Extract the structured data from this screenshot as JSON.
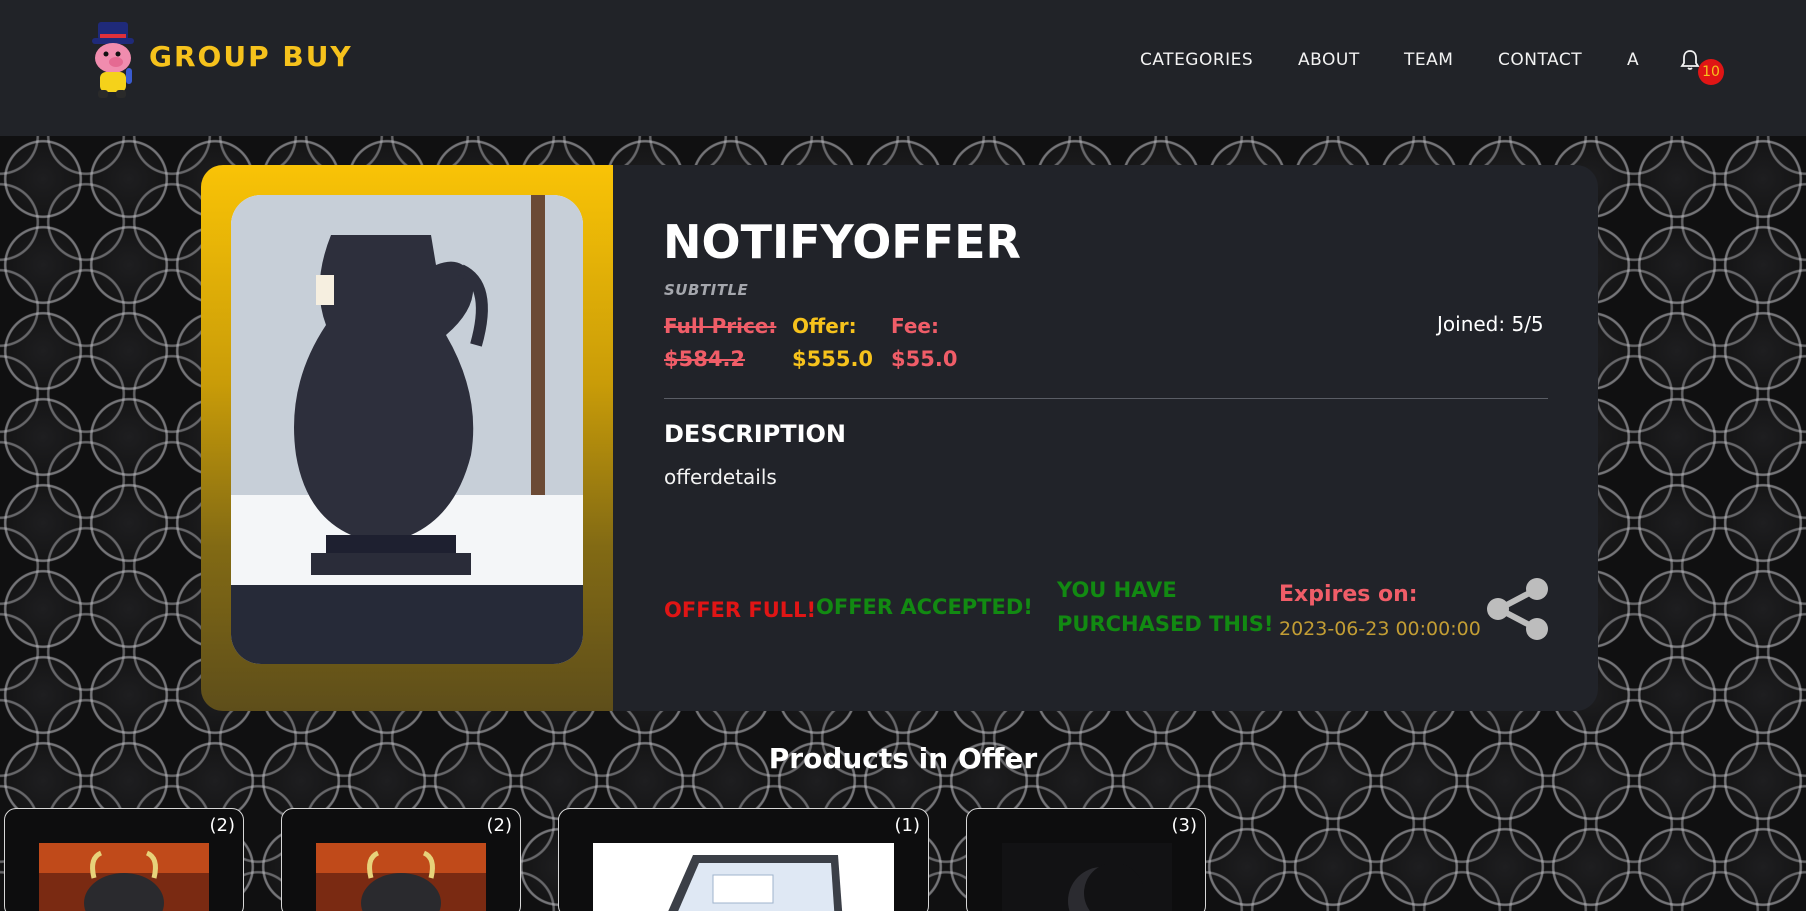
{
  "header": {
    "brand": "GROUP BUY",
    "nav": [
      "CATEGORIES",
      "ABOUT",
      "TEAM",
      "CONTACT",
      "A"
    ],
    "notification_count": "10"
  },
  "offer": {
    "title": "NOTIFYOFFER",
    "subtitle": "SUBTITLE",
    "full_price_label": "Full Price:",
    "full_price": "$584.2",
    "offer_label": "Offer:",
    "offer_price": "$555.0",
    "fee_label": "Fee:",
    "fee": "$55.0",
    "joined": "Joined: 5/5",
    "description_heading": "DESCRIPTION",
    "description": "offerdetails",
    "status_full": "OFFER FULL!",
    "status_accepted": "OFFER ACCEPTED!",
    "status_purchased_1": "YOU HAVE",
    "status_purchased_2": "PURCHASED THIS!",
    "expires_label": "Expires on:",
    "expires_value": "2023-06-23 00:00:00"
  },
  "products": {
    "title": "Products in Offer",
    "items": [
      {
        "qty": "(2)"
      },
      {
        "qty": "(2)"
      },
      {
        "qty": "(1)"
      },
      {
        "qty": "(3)"
      }
    ]
  },
  "colors": {
    "accent_yellow": "#f6c21c",
    "price_red": "#f05d68",
    "offer_full_red": "#e01515",
    "accepted_green": "#128a12",
    "header_bg": "#212328"
  }
}
